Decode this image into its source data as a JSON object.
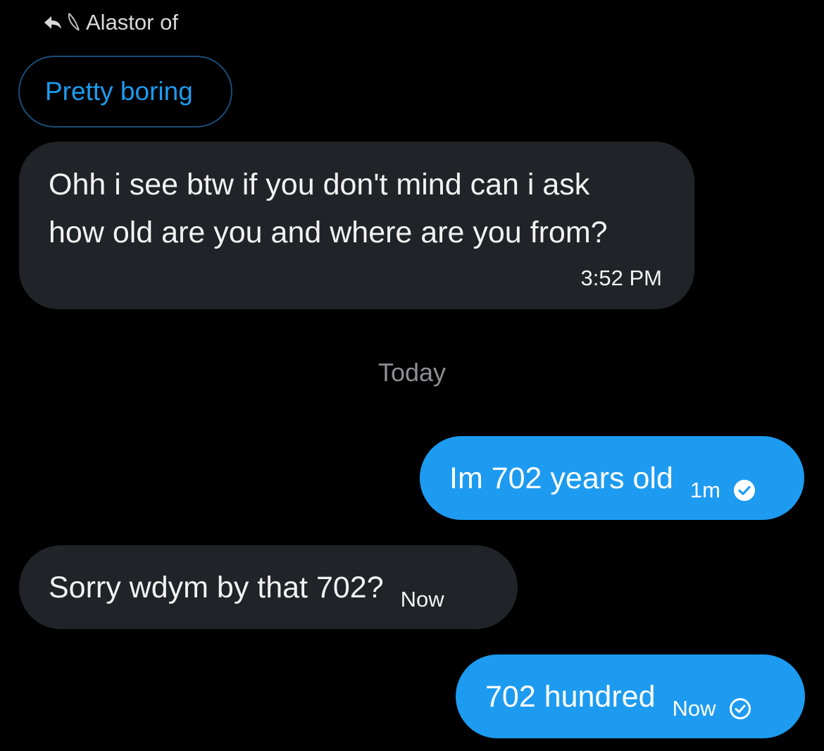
{
  "reply_context": {
    "name": "Alastor of"
  },
  "quoted_message": {
    "text": "Pretty boring"
  },
  "messages": [
    {
      "direction": "received",
      "lines": [
        "Ohh i see btw if you don't mind can i ask",
        "how old are you and where are you from?"
      ],
      "time": "3:52 PM"
    },
    {
      "direction": "sent",
      "text": "Im 702 years old",
      "time": "1m",
      "status_icon": "seen-check-icon"
    },
    {
      "direction": "received",
      "text": "Sorry wdym by that 702?",
      "time": "Now"
    },
    {
      "direction": "sent",
      "text": "702 hundred",
      "time": "Now",
      "status_icon": "sent-check-icon"
    }
  ],
  "day_separator": "Today",
  "colors": {
    "background": "#000000",
    "received_bubble": "#202327",
    "sent_bubble": "#1d9bf0",
    "accent": "#1d9bf0",
    "muted_text": "#8b8f94"
  }
}
